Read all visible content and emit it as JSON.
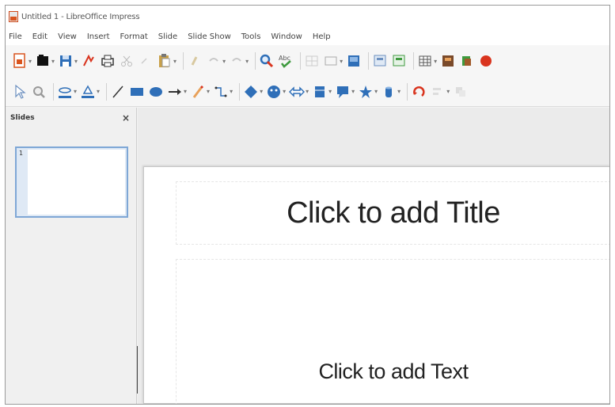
{
  "window": {
    "title": "Untitled 1 - LibreOffice Impress"
  },
  "menu": [
    "File",
    "Edit",
    "View",
    "Insert",
    "Format",
    "Slide",
    "Slide Show",
    "Tools",
    "Window",
    "Help"
  ],
  "toolbar1_icons": [
    "new-document-icon",
    "open-icon",
    "save-icon",
    "export-pdf-icon",
    "print-icon",
    "cut-icon",
    "copy-icon",
    "paste-icon",
    "clone-formatting-icon",
    "undo-icon",
    "redo-icon",
    "find-replace-icon",
    "spellcheck-icon",
    "grid-icon",
    "display-views-icon",
    "image-icon",
    "slide-layout-icon",
    "master-slide-icon",
    "table-icon",
    "chart-icon",
    "media-icon",
    "record-icon"
  ],
  "toolbar2_icons": [
    "select-icon",
    "zoom-icon",
    "line-color-icon",
    "fill-color-icon",
    "line-icon",
    "rectangle-icon",
    "ellipse-icon",
    "arrow-icon",
    "curve-icon",
    "connector-icon",
    "basic-shapes-icon",
    "symbol-shapes-icon",
    "block-arrows-icon",
    "flowchart-icon",
    "callouts-icon",
    "stars-icon",
    "3d-objects-icon",
    "rotate-icon",
    "align-icon",
    "arrange-icon"
  ],
  "slides_panel": {
    "title": "Slides",
    "close": "×",
    "slide_number": "1"
  },
  "slide": {
    "title_placeholder": "Click to add Title",
    "content_placeholder": "Click to add Text"
  },
  "colors": {
    "accent_blue": "#2f6fb8",
    "red": "#d9341e",
    "green": "#3e9a3e",
    "orange": "#d9541e"
  }
}
